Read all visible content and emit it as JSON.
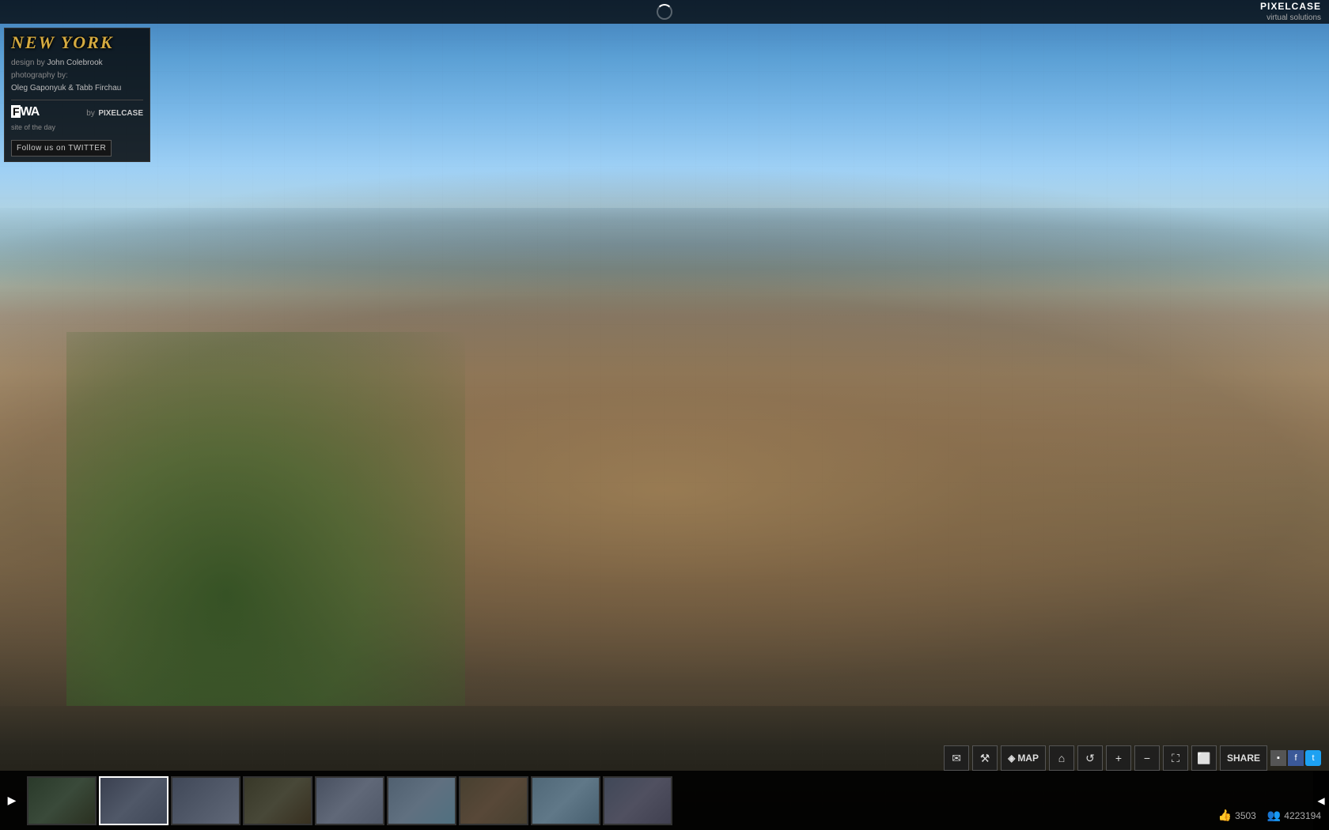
{
  "brand": {
    "name": "PIXELCASE",
    "subtitle": "virtual solutions"
  },
  "info_panel": {
    "title": "NEW YORK",
    "design_label": "design by",
    "design_value": "John Colebrook",
    "photography_label": "photography by:",
    "photographer1": "Oleg Gaponyuk & Tabb Firchau",
    "fwa_logo": "FWA",
    "by_label": "by",
    "pixelcase": "PIXELCASE",
    "site_of_day": "site of the day",
    "twitter_label": "Follow us on TWITTER"
  },
  "toolbar": {
    "email_icon": "✉",
    "wrench_icon": "🔧",
    "map_label": "MAP",
    "home_icon": "⌂",
    "rotate_icon": "↺",
    "zoom_in_icon": "+",
    "zoom_out_icon": "−",
    "fullscreen_icon": "⛶",
    "monitor_icon": "▣",
    "share_label": "SHARE",
    "social_icons": [
      "▪",
      "f",
      "t"
    ]
  },
  "stats": {
    "likes": "3503",
    "viewers": "4223194"
  },
  "filmstrip": {
    "thumbnails": [
      {
        "id": 0,
        "class": "thumb-0"
      },
      {
        "id": 1,
        "class": "thumb-1",
        "active": true
      },
      {
        "id": 2,
        "class": "thumb-2"
      },
      {
        "id": 3,
        "class": "thumb-3"
      },
      {
        "id": 4,
        "class": "thumb-4"
      },
      {
        "id": 5,
        "class": "thumb-5"
      },
      {
        "id": 6,
        "class": "thumb-6"
      },
      {
        "id": 7,
        "class": "thumb-7"
      },
      {
        "id": 8,
        "class": "thumb-8"
      }
    ]
  }
}
